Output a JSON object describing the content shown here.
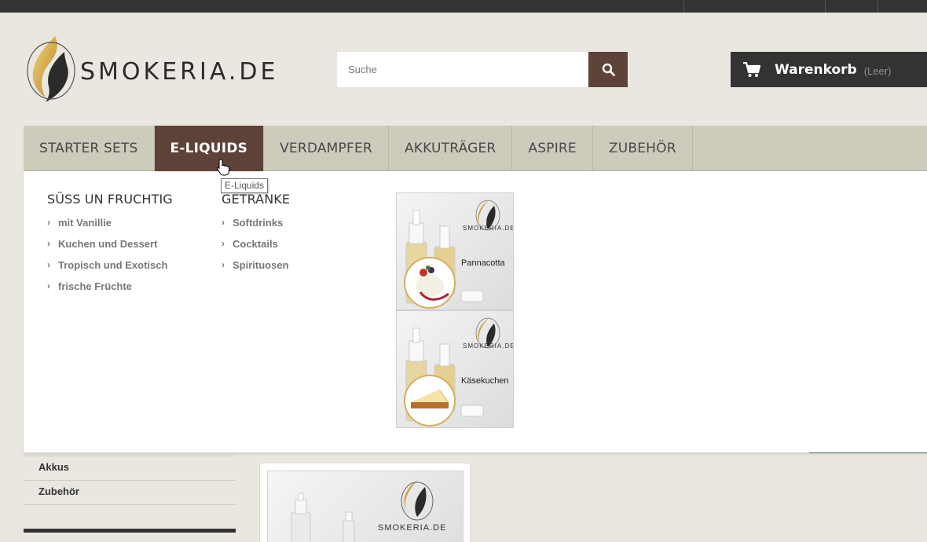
{
  "header": {
    "logo_text": "SMOKERIA.DE",
    "search_placeholder": "Suche",
    "cart_label": "Warenkorb",
    "cart_status": "(Leer)"
  },
  "menu": {
    "items": [
      {
        "label": "STARTER SETS"
      },
      {
        "label": "E-LIQUIDS"
      },
      {
        "label": "VERDAMPFER"
      },
      {
        "label": "AKKUTRÄGER"
      },
      {
        "label": "ASPIRE"
      },
      {
        "label": "ZUBEHÖR"
      }
    ],
    "active_index": 1,
    "tooltip": "E-Liquids"
  },
  "dropdown": {
    "columns": [
      {
        "title": "SÜSS UN FRUCHTIG",
        "links": [
          "mit Vanillie",
          "Kuchen und Dessert",
          "Tropisch und Exotisch",
          "frische Früchte"
        ]
      },
      {
        "title": "GETRÄNKE",
        "links": [
          "Softdrinks",
          "Cocktails",
          "Spirituosen"
        ]
      }
    ],
    "banners": [
      {
        "name": "Pannacotta",
        "brand": "SMOKERIA.DE"
      },
      {
        "name": "Käsekuchen",
        "brand": "SMOKERIA.DE"
      }
    ]
  },
  "sidebar": {
    "items": [
      "Akkus",
      "Zubehör"
    ]
  },
  "product": {
    "brand": "SMOKERIA.DE"
  },
  "colors": {
    "accent_brown": "#5d4337",
    "dark_bar": "#333333",
    "menu_bg": "#cdcbbc"
  }
}
